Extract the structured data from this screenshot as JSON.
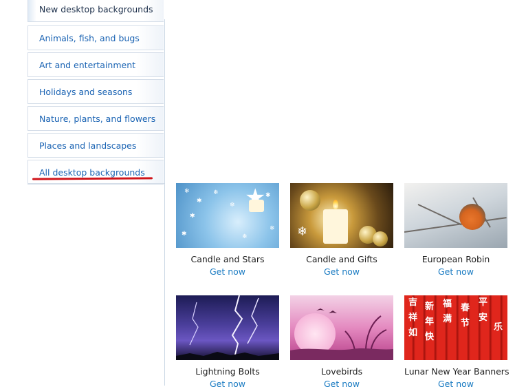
{
  "sidebar": {
    "items": [
      {
        "label": "New desktop backgrounds",
        "active": true
      },
      {
        "label": "Animals, fish, and bugs"
      },
      {
        "label": "Art and entertainment"
      },
      {
        "label": "Holidays and seasons"
      },
      {
        "label": "Nature, plants, and flowers"
      },
      {
        "label": "Places and landscapes"
      },
      {
        "label": "All desktop backgrounds",
        "highlighted": true
      }
    ]
  },
  "gallery": {
    "link_label": "Get now",
    "items": [
      {
        "title": "Candle and Stars"
      },
      {
        "title": "Candle and Gifts"
      },
      {
        "title": "European Robin"
      },
      {
        "title": "Lightning Bolts"
      },
      {
        "title": "Lovebirds"
      },
      {
        "title": "Lunar New Year Banners"
      }
    ]
  },
  "colors": {
    "link": "#1a63b3",
    "get_now": "#1a7bc2",
    "annotation": "#d0141a"
  }
}
